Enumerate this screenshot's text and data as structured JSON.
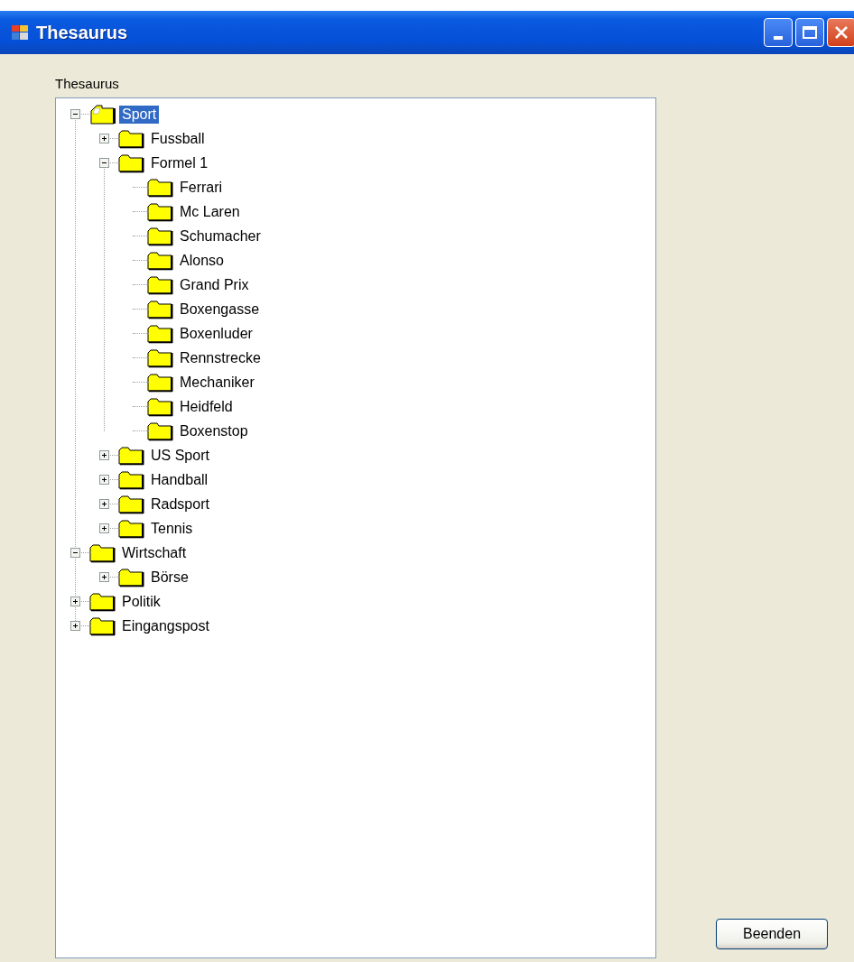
{
  "window": {
    "title": "Thesaurus"
  },
  "tree_label": "Thesaurus",
  "tree": [
    {
      "label": "Sport",
      "selected": true,
      "expandable": true,
      "expanded": true,
      "children": [
        {
          "label": "Fussball",
          "selected": false,
          "expandable": true,
          "expanded": false
        },
        {
          "label": "Formel 1",
          "selected": false,
          "expandable": true,
          "expanded": true,
          "children": [
            {
              "label": "Ferrari",
              "selected": false,
              "expandable": false
            },
            {
              "label": "Mc Laren",
              "selected": false,
              "expandable": false
            },
            {
              "label": "Schumacher",
              "selected": false,
              "expandable": false
            },
            {
              "label": "Alonso",
              "selected": false,
              "expandable": false
            },
            {
              "label": "Grand Prix",
              "selected": false,
              "expandable": false
            },
            {
              "label": "Boxengasse",
              "selected": false,
              "expandable": false
            },
            {
              "label": "Boxenluder",
              "selected": false,
              "expandable": false
            },
            {
              "label": "Rennstrecke",
              "selected": false,
              "expandable": false
            },
            {
              "label": "Mechaniker",
              "selected": false,
              "expandable": false
            },
            {
              "label": "Heidfeld",
              "selected": false,
              "expandable": false
            },
            {
              "label": "Boxenstop",
              "selected": false,
              "expandable": false
            }
          ]
        },
        {
          "label": "US Sport",
          "selected": false,
          "expandable": true,
          "expanded": false
        },
        {
          "label": "Handball",
          "selected": false,
          "expandable": true,
          "expanded": false
        },
        {
          "label": "Radsport",
          "selected": false,
          "expandable": true,
          "expanded": false
        },
        {
          "label": "Tennis",
          "selected": false,
          "expandable": true,
          "expanded": false
        }
      ]
    },
    {
      "label": "Wirtschaft",
      "selected": false,
      "expandable": true,
      "expanded": true,
      "children": [
        {
          "label": "Börse",
          "selected": false,
          "expandable": true,
          "expanded": false
        }
      ]
    },
    {
      "label": "Politik",
      "selected": false,
      "expandable": true,
      "expanded": false
    },
    {
      "label": "Eingangspost",
      "selected": false,
      "expandable": true,
      "expanded": false
    }
  ],
  "buttons": [
    {
      "label": "Beenden"
    }
  ]
}
